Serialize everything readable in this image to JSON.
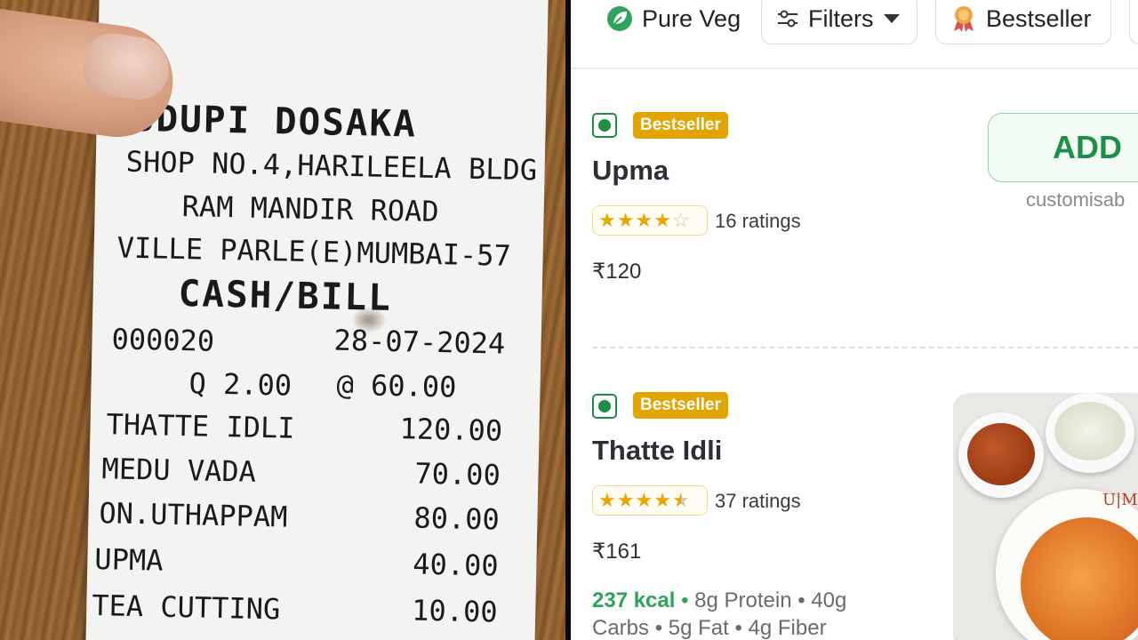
{
  "receipt": {
    "restaurant": "UDUPI DOSAKA",
    "address_line1": "SHOP NO.4,HARILEELA BLDG",
    "address_line2": "RAM MANDIR ROAD",
    "address_line3": "VILLE PARLE(E)MUMBAI-57",
    "bill_type": "CASH/BILL",
    "bill_no": "000020",
    "date": "28-07-2024",
    "qty_line": "Q 2.00",
    "rate_line": "@ 60.00",
    "items": [
      {
        "name": "THATTE IDLI",
        "amount": "120.00"
      },
      {
        "name": "MEDU VADA",
        "amount": "70.00"
      },
      {
        "name": "ON.UTHAPPAM",
        "amount": "80.00"
      },
      {
        "name": "UPMA",
        "amount": "40.00"
      },
      {
        "name": "TEA CUTTING",
        "amount": "10.00"
      }
    ]
  },
  "app": {
    "filters": {
      "pure_veg": "Pure Veg",
      "filters": "Filters",
      "bestseller": "Bestseller"
    },
    "menu_items": [
      {
        "badge": "Bestseller",
        "name": "Upma",
        "rating_stars": 4,
        "ratings_text": "16 ratings",
        "price": "₹120",
        "add_label": "ADD",
        "customisable": "customisab"
      },
      {
        "badge": "Bestseller",
        "name": "Thatte Idli",
        "rating_stars": 4.5,
        "ratings_text": "37 ratings",
        "price": "₹161",
        "kcal": "237 kcal",
        "nutrition_rest1": "8g Protein • 40g",
        "nutrition_rest2": "Carbs • 5g Fat • 4g Fiber",
        "photo_logo": "U|M"
      }
    ],
    "colors": {
      "veg_green": "#1e8f46",
      "bestseller_badge": "#e2a400",
      "star": "#e6a800"
    }
  }
}
